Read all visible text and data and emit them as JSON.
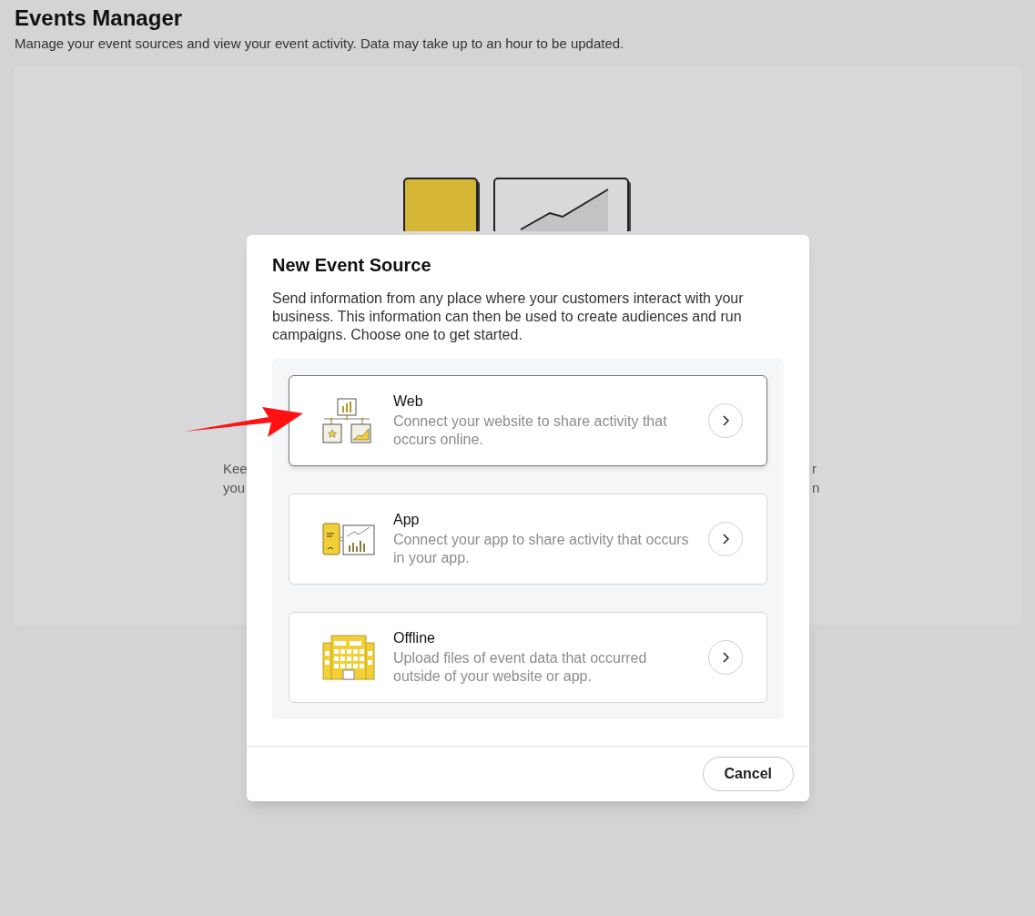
{
  "page": {
    "title": "Events Manager",
    "subtitle": "Manage your event sources and view your event activity. Data may take up to an hour to be updated."
  },
  "background_card": {
    "left_fragments": [
      "Kee",
      "you"
    ],
    "right_fragments": [
      "r",
      "n"
    ]
  },
  "dialog": {
    "title": "New Event Source",
    "description": "Send information from any place where your customers interact with your business. This information can then be used to create audiences and run campaigns. Choose one to get started.",
    "options": [
      {
        "kind": "web",
        "title": "Web",
        "description": "Connect your website to share activity that occurs online.",
        "selected": true
      },
      {
        "kind": "app",
        "title": "App",
        "description": "Connect your app to share activity that occurs in your app.",
        "selected": false
      },
      {
        "kind": "offline",
        "title": "Offline",
        "description": "Upload files of event data that occurred outside of your website or app.",
        "selected": false
      }
    ],
    "buttons": [
      "Cancel"
    ]
  }
}
